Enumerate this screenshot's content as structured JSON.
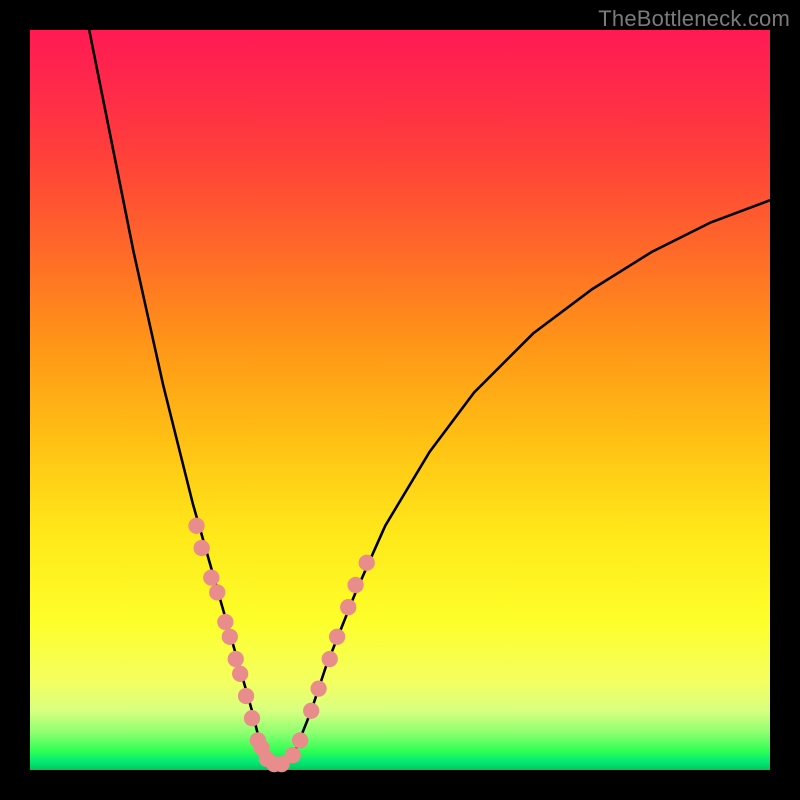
{
  "watermark": "TheBottleneck.com",
  "chart_data": {
    "type": "line",
    "title": "",
    "xlabel": "",
    "ylabel": "",
    "xlim": [
      0,
      100
    ],
    "ylim": [
      0,
      100
    ],
    "background_gradient": {
      "top": "#ff1a53",
      "mid_upper": "#ff9418",
      "mid_lower": "#fdff2a",
      "bottom": "#00c853"
    },
    "series": [
      {
        "name": "bottleneck-curve",
        "color": "#000000",
        "x": [
          8,
          10,
          12,
          14,
          16,
          18,
          20,
          22,
          24,
          26,
          28,
          30,
          31,
          32,
          33,
          34,
          36,
          38,
          40,
          44,
          48,
          54,
          60,
          68,
          76,
          84,
          92,
          100
        ],
        "y": [
          100,
          90,
          80,
          70,
          61,
          52,
          44,
          36,
          29,
          22,
          15,
          8,
          4,
          1,
          0,
          0,
          3,
          8,
          14,
          24,
          33,
          43,
          51,
          59,
          65,
          70,
          74,
          77
        ]
      }
    ],
    "dot_clusters": [
      {
        "name": "left-cluster",
        "color": "#e98c8c",
        "points": [
          {
            "x": 22.5,
            "y": 33
          },
          {
            "x": 23.2,
            "y": 30
          },
          {
            "x": 24.5,
            "y": 26
          },
          {
            "x": 25.3,
            "y": 24
          },
          {
            "x": 26.4,
            "y": 20
          },
          {
            "x": 27.0,
            "y": 18
          },
          {
            "x": 27.8,
            "y": 15
          },
          {
            "x": 28.4,
            "y": 13
          },
          {
            "x": 29.2,
            "y": 10
          },
          {
            "x": 30.0,
            "y": 7
          },
          {
            "x": 30.8,
            "y": 4
          },
          {
            "x": 31.3,
            "y": 3
          },
          {
            "x": 32.0,
            "y": 1.5
          },
          {
            "x": 33.0,
            "y": 0.8
          },
          {
            "x": 34.0,
            "y": 0.8
          }
        ]
      },
      {
        "name": "right-cluster",
        "color": "#e98c8c",
        "points": [
          {
            "x": 35.5,
            "y": 2
          },
          {
            "x": 36.5,
            "y": 4
          },
          {
            "x": 38.0,
            "y": 8
          },
          {
            "x": 39.0,
            "y": 11
          },
          {
            "x": 40.5,
            "y": 15
          },
          {
            "x": 41.5,
            "y": 18
          },
          {
            "x": 43.0,
            "y": 22
          },
          {
            "x": 44.0,
            "y": 25
          },
          {
            "x": 45.5,
            "y": 28
          }
        ]
      }
    ]
  }
}
